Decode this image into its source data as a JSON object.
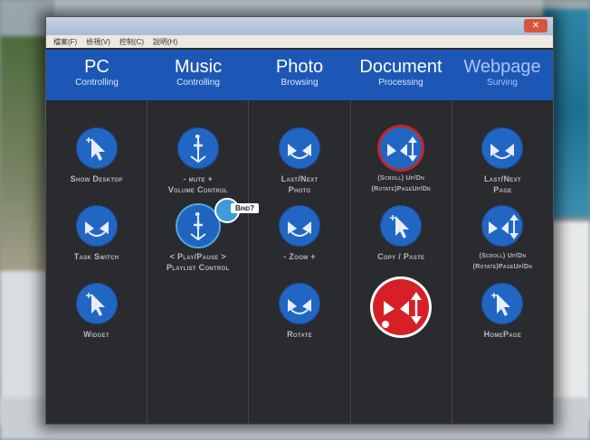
{
  "window": {
    "title": "",
    "menu": [
      "檔案(F)",
      "檢視(V)",
      "控制(C)",
      "說明(H)"
    ]
  },
  "tabs": [
    {
      "title": "PC",
      "subtitle": "Controlling"
    },
    {
      "title": "Music",
      "subtitle": "Controlling"
    },
    {
      "title": "Photo",
      "subtitle": "Browsing"
    },
    {
      "title": "Document",
      "subtitle": "Processing"
    },
    {
      "title": "Webpage",
      "subtitle": "Surving"
    }
  ],
  "columns": {
    "pc": [
      {
        "label": "Show Desktop",
        "icon": "cursor-icon"
      },
      {
        "label": "Task Switch",
        "icon": "arrows-icon"
      },
      {
        "label": "Widget",
        "icon": "cursor-icon"
      }
    ],
    "music": [
      {
        "label_line1": "-  mute  +",
        "label_line2": "Volume Control",
        "icon": "volume-icon"
      },
      {
        "label_line1": "<  Play/Pause  >",
        "label_line2": "Playlist Control",
        "icon": "play-pause-icon"
      }
    ],
    "photo": [
      {
        "label_line1": "Last/Next",
        "label_line2": "Photo",
        "icon": "arrows-icon"
      },
      {
        "label": "-  Zoom  +",
        "icon": "zoom-icon"
      },
      {
        "label": "Rotate",
        "icon": "rotate-icon"
      }
    ],
    "document": [
      {
        "label_line1": "(Scroll) Up/Dn",
        "label_line2": "(Rotate)PageUp/Dn",
        "icon": "scroll-icon"
      },
      {
        "label": "Copy / Paste",
        "icon": "cursor-icon"
      },
      {
        "label": "",
        "icon": "scroll-icon"
      }
    ],
    "webpage": [
      {
        "label_line1": "Last/Next",
        "label_line2": "Page",
        "icon": "arrows-icon"
      },
      {
        "label_line1": "(Scroll) Up/Dn",
        "label_line2": "(Rotate)PageUp/Dn",
        "icon": "scroll-icon"
      },
      {
        "label": "HomePage",
        "icon": "cursor-icon"
      }
    ]
  },
  "bind_badge": {
    "text": "Bind?"
  },
  "colors": {
    "accent": "#1c57b5",
    "button": "#2266c4",
    "panel": "#2a2b2e",
    "highlight": "#d71f26"
  }
}
